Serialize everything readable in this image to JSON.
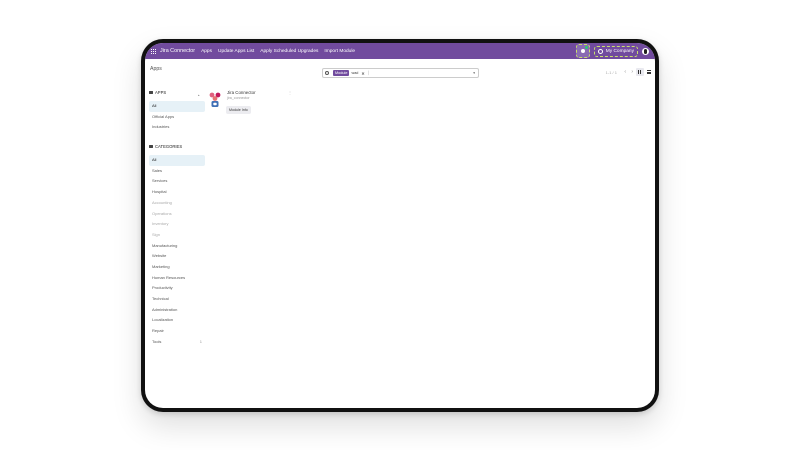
{
  "navbar": {
    "app_name": "Jira Connector",
    "menu": [
      "Apps",
      "Update Apps List",
      "Apply Scheduled Upgrades",
      "Import Module"
    ],
    "company": "My Company",
    "color": "#714b9e"
  },
  "breadcrumb": "Apps",
  "search": {
    "facet_label": "Module",
    "facet_value": "wad",
    "cursor": "│"
  },
  "pager": "1-1 / 1",
  "sidebar": {
    "apps_header": "APPS",
    "apps": [
      "All",
      "Official Apps",
      "Industries"
    ],
    "categories_header": "CATEGORIES",
    "categories": [
      "All",
      "Sales",
      "Services",
      "Hospital",
      "Accounting",
      "Operations",
      "Inventory",
      "Sign",
      "Manufacturing",
      "Website",
      "Marketing",
      "Human Resources",
      "Productivity",
      "Technical",
      "Administration",
      "Localization",
      "Repair",
      "Tools"
    ],
    "tools_count": "1"
  },
  "module": {
    "title": "Jira Connector",
    "technical_name": "jira_connector",
    "button": "Module Info"
  }
}
